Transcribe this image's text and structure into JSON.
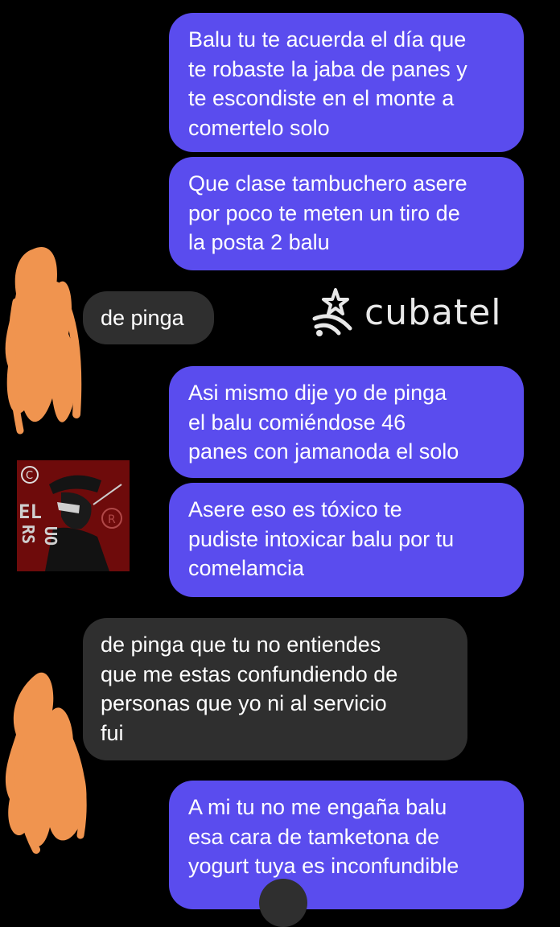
{
  "messages": [
    {
      "from": "me",
      "lines": [
        "Balu tu te acuerda el día que",
        "te robaste la jaba de panes y",
        "te escondiste en el monte a",
        "comertelo solo"
      ]
    },
    {
      "from": "me",
      "lines": [
        "Que clase tambuchero asere",
        "por poco te meten un tiro de",
        "la posta 2 balu"
      ]
    },
    {
      "from": "them",
      "lines": [
        "de pinga"
      ]
    },
    {
      "from": "me",
      "lines": [
        "Asi mismo dije yo de pinga",
        "el balu comiéndose 46",
        "panes con jamanoda el solo"
      ]
    },
    {
      "from": "me",
      "lines": [
        "Asere eso es tóxico te",
        "pudiste intoxicar balu por tu",
        "comelamcia"
      ]
    },
    {
      "from": "them",
      "lines": [
        "de pinga que tu no entiendes",
        "que me estas confundiendo de",
        "personas que yo ni al servicio",
        "fui"
      ]
    },
    {
      "from": "me",
      "lines": [
        "A mi tu no me engaña balu",
        "esa cara de tamketona de",
        "yogurt tuya es inconfundible"
      ]
    }
  ],
  "watermark": {
    "text": "cubatel",
    "icon": "star-wifi-icon"
  },
  "avatar": {
    "letters": [
      "EL",
      "RS",
      "UO"
    ],
    "marks": [
      "©",
      "®"
    ]
  },
  "colors": {
    "sent_bubble": "#5a4cee",
    "received_bubble": "#2f2f2f",
    "background": "#000000",
    "scribble": "#f0944f"
  }
}
